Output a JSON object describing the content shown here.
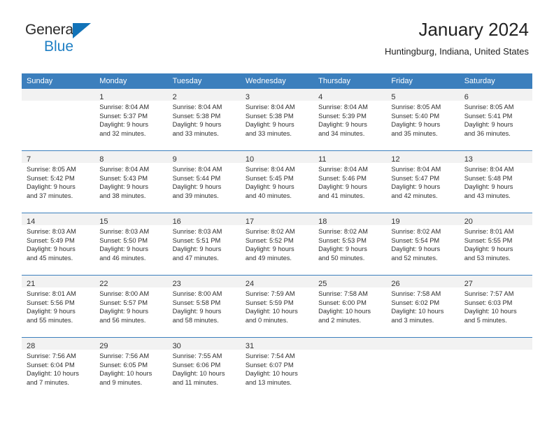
{
  "brand": {
    "name_top": "General",
    "name_bottom": "Blue",
    "triangle_color": "#1273b8",
    "blue_text_color": "#1f7fc4"
  },
  "header": {
    "title": "January 2024",
    "subtitle": "Huntingburg, Indiana, United States"
  },
  "theme": {
    "header_bg": "#3c7fbd",
    "header_text": "#ffffff",
    "daynum_band_bg": "#f2f2f2",
    "row_divider": "#3c7fbd",
    "cell_bg": "#ffffff"
  },
  "weekdays": [
    "Sunday",
    "Monday",
    "Tuesday",
    "Wednesday",
    "Thursday",
    "Friday",
    "Saturday"
  ],
  "weeks": [
    [
      {
        "day": "",
        "sunrise": "",
        "sunset": "",
        "daylight_line1": "",
        "daylight_line2": ""
      },
      {
        "day": "1",
        "sunrise": "Sunrise: 8:04 AM",
        "sunset": "Sunset: 5:37 PM",
        "daylight_line1": "Daylight: 9 hours",
        "daylight_line2": "and 32 minutes."
      },
      {
        "day": "2",
        "sunrise": "Sunrise: 8:04 AM",
        "sunset": "Sunset: 5:38 PM",
        "daylight_line1": "Daylight: 9 hours",
        "daylight_line2": "and 33 minutes."
      },
      {
        "day": "3",
        "sunrise": "Sunrise: 8:04 AM",
        "sunset": "Sunset: 5:38 PM",
        "daylight_line1": "Daylight: 9 hours",
        "daylight_line2": "and 33 minutes."
      },
      {
        "day": "4",
        "sunrise": "Sunrise: 8:04 AM",
        "sunset": "Sunset: 5:39 PM",
        "daylight_line1": "Daylight: 9 hours",
        "daylight_line2": "and 34 minutes."
      },
      {
        "day": "5",
        "sunrise": "Sunrise: 8:05 AM",
        "sunset": "Sunset: 5:40 PM",
        "daylight_line1": "Daylight: 9 hours",
        "daylight_line2": "and 35 minutes."
      },
      {
        "day": "6",
        "sunrise": "Sunrise: 8:05 AM",
        "sunset": "Sunset: 5:41 PM",
        "daylight_line1": "Daylight: 9 hours",
        "daylight_line2": "and 36 minutes."
      }
    ],
    [
      {
        "day": "7",
        "sunrise": "Sunrise: 8:05 AM",
        "sunset": "Sunset: 5:42 PM",
        "daylight_line1": "Daylight: 9 hours",
        "daylight_line2": "and 37 minutes."
      },
      {
        "day": "8",
        "sunrise": "Sunrise: 8:04 AM",
        "sunset": "Sunset: 5:43 PM",
        "daylight_line1": "Daylight: 9 hours",
        "daylight_line2": "and 38 minutes."
      },
      {
        "day": "9",
        "sunrise": "Sunrise: 8:04 AM",
        "sunset": "Sunset: 5:44 PM",
        "daylight_line1": "Daylight: 9 hours",
        "daylight_line2": "and 39 minutes."
      },
      {
        "day": "10",
        "sunrise": "Sunrise: 8:04 AM",
        "sunset": "Sunset: 5:45 PM",
        "daylight_line1": "Daylight: 9 hours",
        "daylight_line2": "and 40 minutes."
      },
      {
        "day": "11",
        "sunrise": "Sunrise: 8:04 AM",
        "sunset": "Sunset: 5:46 PM",
        "daylight_line1": "Daylight: 9 hours",
        "daylight_line2": "and 41 minutes."
      },
      {
        "day": "12",
        "sunrise": "Sunrise: 8:04 AM",
        "sunset": "Sunset: 5:47 PM",
        "daylight_line1": "Daylight: 9 hours",
        "daylight_line2": "and 42 minutes."
      },
      {
        "day": "13",
        "sunrise": "Sunrise: 8:04 AM",
        "sunset": "Sunset: 5:48 PM",
        "daylight_line1": "Daylight: 9 hours",
        "daylight_line2": "and 43 minutes."
      }
    ],
    [
      {
        "day": "14",
        "sunrise": "Sunrise: 8:03 AM",
        "sunset": "Sunset: 5:49 PM",
        "daylight_line1": "Daylight: 9 hours",
        "daylight_line2": "and 45 minutes."
      },
      {
        "day": "15",
        "sunrise": "Sunrise: 8:03 AM",
        "sunset": "Sunset: 5:50 PM",
        "daylight_line1": "Daylight: 9 hours",
        "daylight_line2": "and 46 minutes."
      },
      {
        "day": "16",
        "sunrise": "Sunrise: 8:03 AM",
        "sunset": "Sunset: 5:51 PM",
        "daylight_line1": "Daylight: 9 hours",
        "daylight_line2": "and 47 minutes."
      },
      {
        "day": "17",
        "sunrise": "Sunrise: 8:02 AM",
        "sunset": "Sunset: 5:52 PM",
        "daylight_line1": "Daylight: 9 hours",
        "daylight_line2": "and 49 minutes."
      },
      {
        "day": "18",
        "sunrise": "Sunrise: 8:02 AM",
        "sunset": "Sunset: 5:53 PM",
        "daylight_line1": "Daylight: 9 hours",
        "daylight_line2": "and 50 minutes."
      },
      {
        "day": "19",
        "sunrise": "Sunrise: 8:02 AM",
        "sunset": "Sunset: 5:54 PM",
        "daylight_line1": "Daylight: 9 hours",
        "daylight_line2": "and 52 minutes."
      },
      {
        "day": "20",
        "sunrise": "Sunrise: 8:01 AM",
        "sunset": "Sunset: 5:55 PM",
        "daylight_line1": "Daylight: 9 hours",
        "daylight_line2": "and 53 minutes."
      }
    ],
    [
      {
        "day": "21",
        "sunrise": "Sunrise: 8:01 AM",
        "sunset": "Sunset: 5:56 PM",
        "daylight_line1": "Daylight: 9 hours",
        "daylight_line2": "and 55 minutes."
      },
      {
        "day": "22",
        "sunrise": "Sunrise: 8:00 AM",
        "sunset": "Sunset: 5:57 PM",
        "daylight_line1": "Daylight: 9 hours",
        "daylight_line2": "and 56 minutes."
      },
      {
        "day": "23",
        "sunrise": "Sunrise: 8:00 AM",
        "sunset": "Sunset: 5:58 PM",
        "daylight_line1": "Daylight: 9 hours",
        "daylight_line2": "and 58 minutes."
      },
      {
        "day": "24",
        "sunrise": "Sunrise: 7:59 AM",
        "sunset": "Sunset: 5:59 PM",
        "daylight_line1": "Daylight: 10 hours",
        "daylight_line2": "and 0 minutes."
      },
      {
        "day": "25",
        "sunrise": "Sunrise: 7:58 AM",
        "sunset": "Sunset: 6:00 PM",
        "daylight_line1": "Daylight: 10 hours",
        "daylight_line2": "and 2 minutes."
      },
      {
        "day": "26",
        "sunrise": "Sunrise: 7:58 AM",
        "sunset": "Sunset: 6:02 PM",
        "daylight_line1": "Daylight: 10 hours",
        "daylight_line2": "and 3 minutes."
      },
      {
        "day": "27",
        "sunrise": "Sunrise: 7:57 AM",
        "sunset": "Sunset: 6:03 PM",
        "daylight_line1": "Daylight: 10 hours",
        "daylight_line2": "and 5 minutes."
      }
    ],
    [
      {
        "day": "28",
        "sunrise": "Sunrise: 7:56 AM",
        "sunset": "Sunset: 6:04 PM",
        "daylight_line1": "Daylight: 10 hours",
        "daylight_line2": "and 7 minutes."
      },
      {
        "day": "29",
        "sunrise": "Sunrise: 7:56 AM",
        "sunset": "Sunset: 6:05 PM",
        "daylight_line1": "Daylight: 10 hours",
        "daylight_line2": "and 9 minutes."
      },
      {
        "day": "30",
        "sunrise": "Sunrise: 7:55 AM",
        "sunset": "Sunset: 6:06 PM",
        "daylight_line1": "Daylight: 10 hours",
        "daylight_line2": "and 11 minutes."
      },
      {
        "day": "31",
        "sunrise": "Sunrise: 7:54 AM",
        "sunset": "Sunset: 6:07 PM",
        "daylight_line1": "Daylight: 10 hours",
        "daylight_line2": "and 13 minutes."
      },
      {
        "day": "",
        "sunrise": "",
        "sunset": "",
        "daylight_line1": "",
        "daylight_line2": ""
      },
      {
        "day": "",
        "sunrise": "",
        "sunset": "",
        "daylight_line1": "",
        "daylight_line2": ""
      },
      {
        "day": "",
        "sunrise": "",
        "sunset": "",
        "daylight_line1": "",
        "daylight_line2": ""
      }
    ]
  ]
}
